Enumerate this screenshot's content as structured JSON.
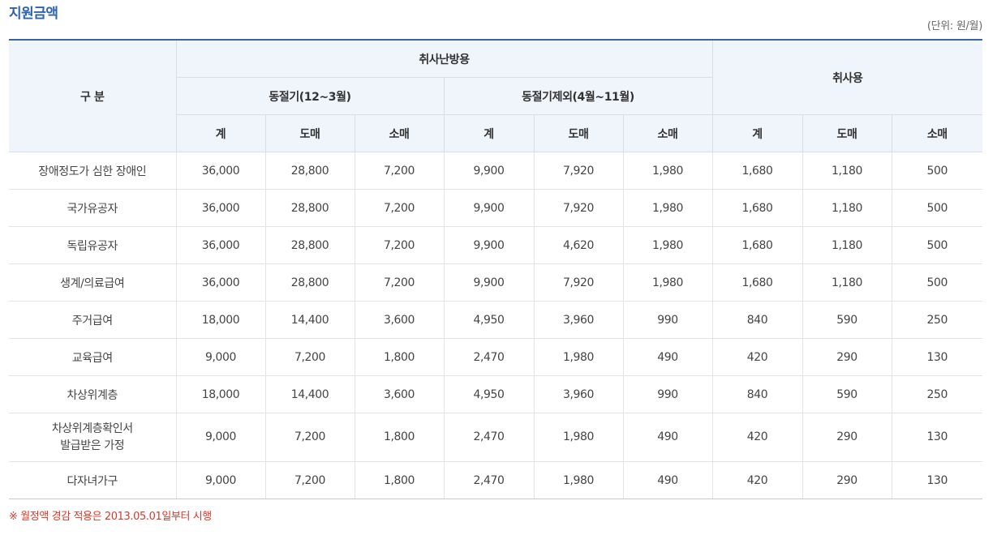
{
  "title": "지원금액",
  "unit": "(단위: 원/월)",
  "header": {
    "category": "구 분",
    "cooking_heating": "취사난방용",
    "winter": "동절기(12~3월)",
    "non_winter": "동절기제외(4월~11월)",
    "cooking": "취사용",
    "sub": [
      "계",
      "도매",
      "소매",
      "계",
      "도매",
      "소매",
      "계",
      "도매",
      "소매"
    ]
  },
  "rows": [
    {
      "label": [
        "장애정도가 심한 장애인"
      ],
      "values": [
        "36,000",
        "28,800",
        "7,200",
        "9,900",
        "7,920",
        "1,980",
        "1,680",
        "1,180",
        "500"
      ]
    },
    {
      "label": [
        "국가유공자"
      ],
      "values": [
        "36,000",
        "28,800",
        "7,200",
        "9,900",
        "7,920",
        "1,980",
        "1,680",
        "1,180",
        "500"
      ]
    },
    {
      "label": [
        "독립유공자"
      ],
      "values": [
        "36,000",
        "28,800",
        "7,200",
        "9,900",
        "4,620",
        "1,980",
        "1,680",
        "1,180",
        "500"
      ]
    },
    {
      "label": [
        "생계/의료급여"
      ],
      "values": [
        "36,000",
        "28,800",
        "7,200",
        "9,900",
        "7,920",
        "1,980",
        "1,680",
        "1,180",
        "500"
      ]
    },
    {
      "label": [
        "주거급여"
      ],
      "values": [
        "18,000",
        "14,400",
        "3,600",
        "4,950",
        "3,960",
        "990",
        "840",
        "590",
        "250"
      ]
    },
    {
      "label": [
        "교육급여"
      ],
      "values": [
        "9,000",
        "7,200",
        "1,800",
        "2,470",
        "1,980",
        "490",
        "420",
        "290",
        "130"
      ]
    },
    {
      "label": [
        "차상위계층"
      ],
      "values": [
        "18,000",
        "14,400",
        "3,600",
        "4,950",
        "3,960",
        "990",
        "840",
        "590",
        "250"
      ]
    },
    {
      "label": [
        "차상위계층확인서",
        "발급받은 가정"
      ],
      "values": [
        "9,000",
        "7,200",
        "1,800",
        "2,470",
        "1,980",
        "490",
        "420",
        "290",
        "130"
      ]
    },
    {
      "label": [
        "다자녀가구"
      ],
      "values": [
        "9,000",
        "7,200",
        "1,800",
        "2,470",
        "1,980",
        "490",
        "420",
        "290",
        "130"
      ]
    }
  ],
  "note": "※ 월정액 경감 적용은 2013.05.01일부터 시행"
}
